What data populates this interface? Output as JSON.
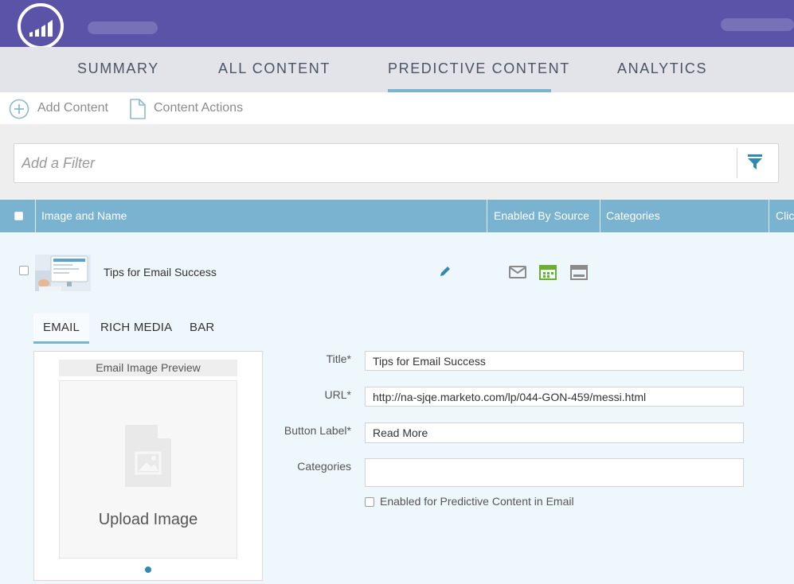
{
  "nav": {
    "tabs": [
      {
        "label": "SUMMARY"
      },
      {
        "label": "ALL CONTENT"
      },
      {
        "label": "PREDICTIVE CONTENT",
        "active": true
      },
      {
        "label": "ANALYTICS"
      }
    ]
  },
  "toolbar": {
    "add_content": "Add Content",
    "content_actions": "Content Actions"
  },
  "filter": {
    "placeholder": "Add a Filter"
  },
  "table": {
    "columns": [
      "Image and Name",
      "Enabled By Source",
      "Categories",
      "Clic"
    ]
  },
  "row": {
    "name": "Tips for Email Success",
    "source_icons": [
      "email-icon",
      "rich-media-icon",
      "bar-icon"
    ]
  },
  "detail": {
    "tabs": [
      "EMAIL",
      "RICH MEDIA",
      "BAR"
    ],
    "preview_title": "Email Image Preview",
    "upload_label": "Upload Image",
    "form": {
      "title_label": "Title*",
      "title_value": "Tips for Email Success",
      "url_label": "URL*",
      "url_value": "http://na-sjqe.marketo.com/lp/044-GON-459/messi.html",
      "button_label_label": "Button Label*",
      "button_label_value": "Read More",
      "categories_label": "Categories",
      "categories_value": "",
      "enabled_label": "Enabled for Predictive Content in Email"
    }
  },
  "colors": {
    "brand_purple": "#5a53a8",
    "header_blue": "#7ab3cf",
    "accent_blue": "#2f89b4",
    "enabled_green": "#6cae2e"
  }
}
